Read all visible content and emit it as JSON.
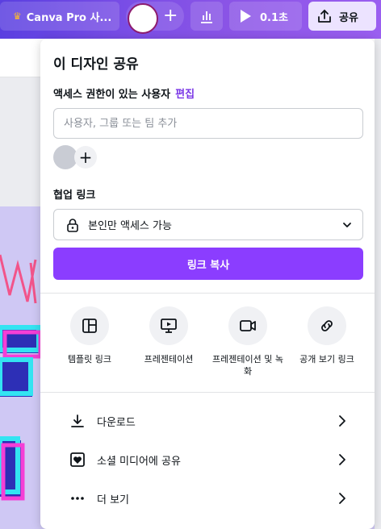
{
  "topbar": {
    "pro_label": "Canva Pro 사...",
    "present_label": "0.1초",
    "share_label": "공유"
  },
  "panel": {
    "title": "이 디자인 공유",
    "access_label": "액세스 권한이 있는 사용자",
    "edit_label": "편집",
    "people_placeholder": "사용자, 그룹 또는 팀 추가",
    "collab_label": "협업 링크",
    "access_value": "본인만 액세스 가능",
    "copy_label": "링크 복사",
    "options": [
      {
        "label": "템플릿 링크",
        "icon": "template-icon"
      },
      {
        "label": "프레젠테이션",
        "icon": "presentation-icon"
      },
      {
        "label": "프레젠테이션 및 녹화",
        "icon": "video-camera-icon"
      },
      {
        "label": "공개 보기 링크",
        "icon": "link-icon"
      }
    ],
    "actions": [
      {
        "label": "다운로드",
        "icon": "download-icon"
      },
      {
        "label": "소셜 미디어에 공유",
        "icon": "heart-icon"
      },
      {
        "label": "더 보기",
        "icon": "more-icon"
      }
    ]
  },
  "colors": {
    "accent": "#8b3dff",
    "link": "#7a37e6",
    "topbar_start": "#5a3fe0",
    "topbar_end": "#9a5ef0"
  }
}
